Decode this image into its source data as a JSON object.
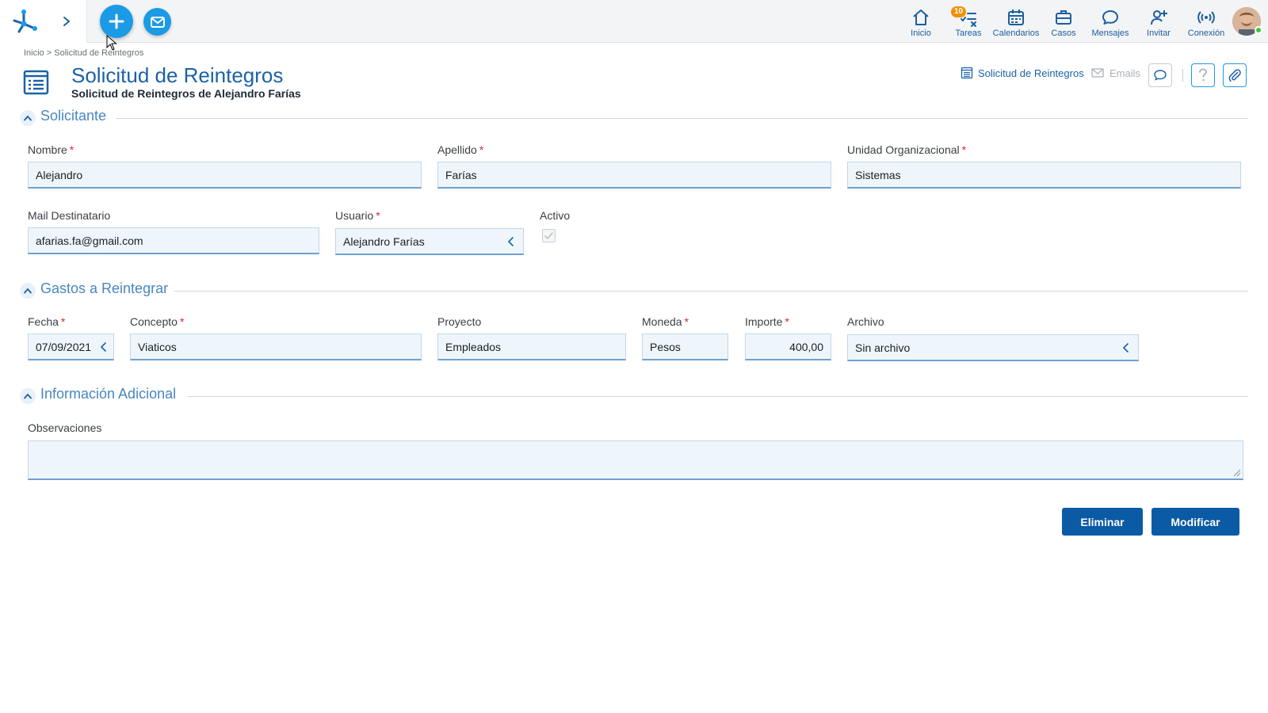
{
  "nav": {
    "items": [
      {
        "key": "inicio",
        "label": "Inicio",
        "icon": "home-icon"
      },
      {
        "key": "tareas",
        "label": "Tareas",
        "icon": "tasks-icon",
        "badge": "10"
      },
      {
        "key": "calendarios",
        "label": "Calendarios",
        "icon": "calendar-icon"
      },
      {
        "key": "casos",
        "label": "Casos",
        "icon": "briefcase-icon"
      },
      {
        "key": "mensajes",
        "label": "Mensajes",
        "icon": "chat-icon"
      },
      {
        "key": "invitar",
        "label": "Invitar",
        "icon": "invite-user-icon"
      },
      {
        "key": "conexion",
        "label": "Conexión",
        "icon": "signal-icon"
      }
    ],
    "badge_color": "#f29100",
    "accent_color": "#1b9ae6"
  },
  "breadcrumb": {
    "home": "Inicio",
    "separator": ">",
    "current": "Solicitud de Reintegros"
  },
  "header": {
    "title": "Solicitud de Reintegros",
    "subtitle": "Solicitud de Reintegros de Alejandro Farías",
    "form_link": "Solicitud de Reintegros",
    "emails_link": "Emails"
  },
  "sections": {
    "solicitante": "Solicitante",
    "gastos": "Gastos a Reintegrar",
    "info": "Información Adicional"
  },
  "solicitante": {
    "nombre_label": "Nombre",
    "nombre": "Alejandro",
    "apellido_label": "Apellido",
    "apellido": "Farías",
    "unidad_label": "Unidad Organizacional",
    "unidad": "Sistemas",
    "mail_label": "Mail Destinatario",
    "mail": "afarias.fa@gmail.com",
    "usuario_label": "Usuario",
    "usuario": "Alejandro Farías",
    "activo_label": "Activo",
    "activo": true
  },
  "gastos": {
    "fecha_label": "Fecha",
    "fecha": "07/09/2021",
    "concepto_label": "Concepto",
    "concepto": "Viaticos",
    "proyecto_label": "Proyecto",
    "proyecto": "Empleados",
    "moneda_label": "Moneda",
    "moneda": "Pesos",
    "importe_label": "Importe",
    "importe": "400,00",
    "archivo_label": "Archivo",
    "archivo": "Sin archivo"
  },
  "info": {
    "observaciones_label": "Observaciones",
    "observaciones": ""
  },
  "actions": {
    "eliminar": "Eliminar",
    "modificar": "Modificar"
  },
  "required_mark": "*"
}
